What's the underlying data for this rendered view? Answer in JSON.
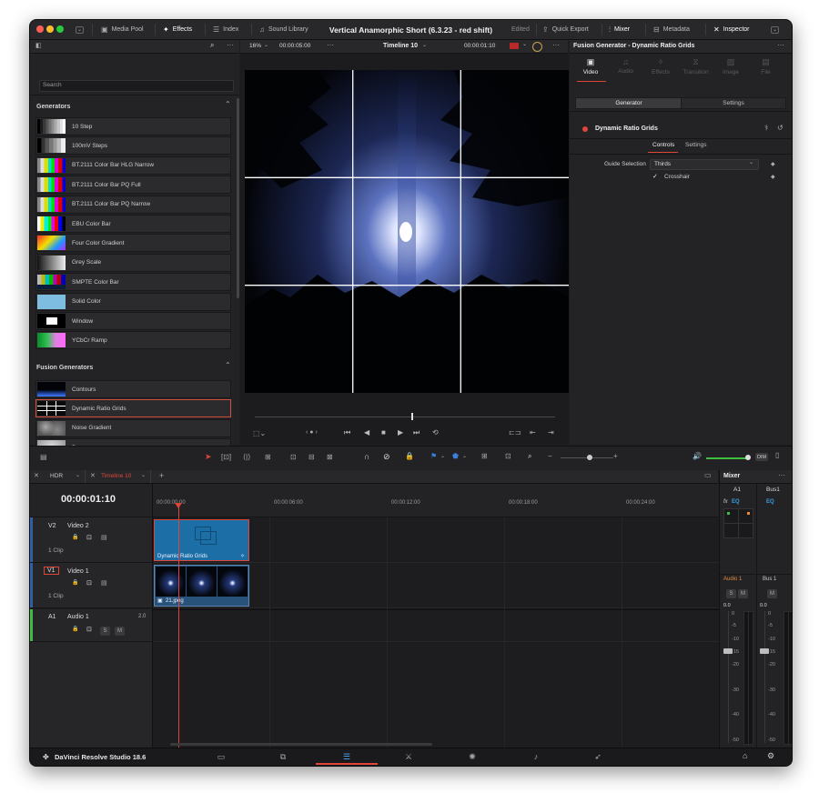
{
  "app": {
    "project_title": "Vertical Anamorphic Short (6.3.23 - red shift)",
    "edited_status": "Edited",
    "name": "DaVinci Resolve Studio 18.6"
  },
  "toolbar": {
    "media_pool": "Media Pool",
    "effects": "Effects",
    "index": "Index",
    "sound_library": "Sound Library",
    "quick_export": "Quick Export",
    "mixer": "Mixer",
    "metadata": "Metadata",
    "inspector": "Inspector"
  },
  "effects_panel": {
    "search_placeholder": "Search",
    "generators_header": "Generators",
    "generators": [
      {
        "label": "10 Step",
        "icon": "ten-step-thumb"
      },
      {
        "label": "100mV Steps",
        "icon": "100mv-steps-thumb"
      },
      {
        "label": "BT.2111 Color Bar HLG Narrow",
        "icon": "colorbar-thumb"
      },
      {
        "label": "BT.2111 Color Bar PQ Full",
        "icon": "colorbar-thumb"
      },
      {
        "label": "BT.2111 Color Bar PQ Narrow",
        "icon": "colorbar-thumb"
      },
      {
        "label": "EBU Color Bar",
        "icon": "ebu-colorbar-thumb"
      },
      {
        "label": "Four Color Gradient",
        "icon": "gradient-thumb"
      },
      {
        "label": "Grey Scale",
        "icon": "greyscale-thumb"
      },
      {
        "label": "SMPTE Color Bar",
        "icon": "smpte-thumb"
      },
      {
        "label": "Solid Color",
        "icon": "solid-color-thumb"
      },
      {
        "label": "Window",
        "icon": "window-thumb"
      },
      {
        "label": "YCbCr Ramp",
        "icon": "ycbcr-ramp-thumb"
      }
    ],
    "fusion_header": "Fusion Generators",
    "fusion_generators": [
      {
        "label": "Contours",
        "icon": "contours-thumb"
      },
      {
        "label": "Dynamic Ratio Grids",
        "icon": "grid-thumb"
      },
      {
        "label": "Noise Gradient",
        "icon": "noise-thumb"
      },
      {
        "label": "Paper",
        "icon": "paper-thumb"
      }
    ]
  },
  "viewer": {
    "zoom": "16%",
    "duration_tc": "00:00:05:00",
    "timeline_name": "Timeline 10",
    "current_tc": "00:00:01:10",
    "playhead_fraction": 0.52
  },
  "inspector": {
    "title": "Fusion Generator - Dynamic Ratio Grids",
    "tabs": [
      "Video",
      "Audio",
      "Effects",
      "Transition",
      "Image",
      "File"
    ],
    "subtabs": [
      "Generator",
      "Settings"
    ],
    "clip_name": "Dynamic Ratio Grids",
    "control_tabs": [
      "Controls",
      "Settings"
    ],
    "guide_selection_label": "Guide Selection",
    "guide_selection_value": "Thirds",
    "crosshair_label": "Crosshair",
    "crosshair_checked": "✓"
  },
  "timeline": {
    "tabs": [
      "HDR",
      "Timeline 10"
    ],
    "timecode": "00:00:01:10",
    "ruler": [
      "00:00:00:00",
      "00:00:06:00",
      "00:00:12:00",
      "00:00:18:00",
      "00:00:24:00"
    ],
    "tracks": [
      {
        "id": "V2",
        "name": "Video 2",
        "clips": "1 Clip"
      },
      {
        "id": "V1",
        "name": "Video 1",
        "clips": "1 Clip"
      },
      {
        "id": "A1",
        "name": "Audio 1",
        "channels": "2.0"
      }
    ],
    "v2_clip": "Dynamic Ratio Grids",
    "v1_clip": "21.jpeg",
    "solo": "S",
    "mute": "M"
  },
  "mixer": {
    "title": "Mixer",
    "channels": [
      "A1",
      "Bus1"
    ],
    "fx": "fx",
    "eq": "EQ",
    "strip_labels": [
      "Audio 1",
      "Bus 1"
    ],
    "level_values": [
      "0.0",
      "0.0"
    ],
    "scale": [
      "0",
      "-5",
      "-10",
      "-15",
      "-20",
      "-30",
      "-40",
      "-50"
    ],
    "dim": "DIM"
  },
  "colors": {
    "accent_red": "#e0453a",
    "clip_blue": "#1c6ea6",
    "selection_orange": "#e58a3c",
    "level_green": "#3fbf3f"
  }
}
